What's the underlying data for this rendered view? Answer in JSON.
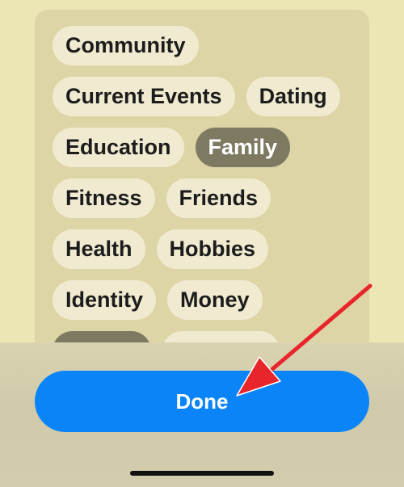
{
  "topics": {
    "rows": [
      [
        {
          "label": "Community",
          "selected": false
        }
      ],
      [
        {
          "label": "Current Events",
          "selected": false
        },
        {
          "label": "Dating",
          "selected": false
        }
      ],
      [
        {
          "label": "Education",
          "selected": false
        },
        {
          "label": "Family",
          "selected": true
        }
      ],
      [
        {
          "label": "Fitness",
          "selected": false
        },
        {
          "label": "Friends",
          "selected": false
        }
      ],
      [
        {
          "label": "Health",
          "selected": false
        },
        {
          "label": "Hobbies",
          "selected": false
        }
      ],
      [
        {
          "label": "Identity",
          "selected": false
        },
        {
          "label": "Money",
          "selected": false
        }
      ],
      [
        {
          "label": "",
          "selected": true
        },
        {
          "label": "",
          "selected": false
        }
      ]
    ]
  },
  "done_button": {
    "label": "Done"
  },
  "colors": {
    "accent": "#0b84f8",
    "chip": "#f0ead0",
    "chip_selected": "#7e7a62",
    "annotation_arrow": "#e8252b"
  }
}
